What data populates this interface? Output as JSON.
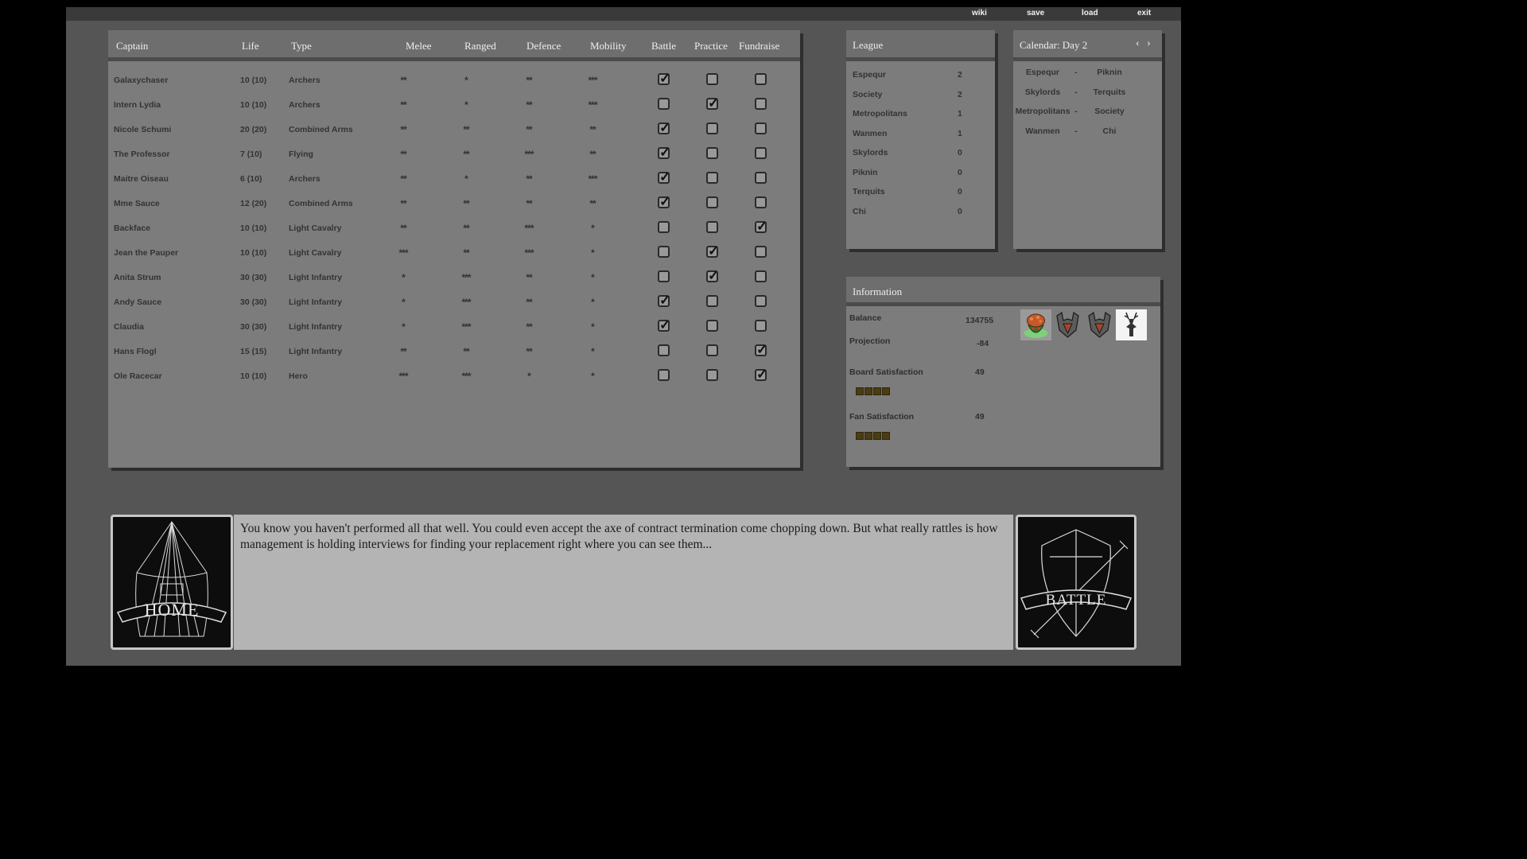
{
  "nav": {
    "wiki": "wiki",
    "save": "save",
    "load": "load",
    "exit": "exit"
  },
  "roster": {
    "headers": [
      "Captain",
      "Life",
      "Type",
      "Melee",
      "Ranged",
      "Defence",
      "Mobility",
      "Battle",
      "Practice",
      "Fundraise"
    ],
    "rows": [
      {
        "name": "Galaxychaser",
        "life": "10 (10)",
        "type": "Archers",
        "melee": "**",
        "ranged": "*",
        "defence": "**",
        "mobility": "***",
        "battle": true,
        "practice": false,
        "fundraise": false
      },
      {
        "name": "Intern Lydia",
        "life": "10 (10)",
        "type": "Archers",
        "melee": "**",
        "ranged": "*",
        "defence": "**",
        "mobility": "***",
        "battle": false,
        "practice": true,
        "fundraise": false
      },
      {
        "name": "Nicole Schumi",
        "life": "20 (20)",
        "type": "Combined Arms",
        "melee": "**",
        "ranged": "**",
        "defence": "**",
        "mobility": "**",
        "battle": true,
        "practice": false,
        "fundraise": false
      },
      {
        "name": "The Professor",
        "life": "7 (10)",
        "type": "Flying",
        "melee": "**",
        "ranged": "**",
        "defence": "***",
        "mobility": "**",
        "battle": true,
        "practice": false,
        "fundraise": false
      },
      {
        "name": "Maitre Oiseau",
        "life": "6 (10)",
        "type": "Archers",
        "melee": "**",
        "ranged": "*",
        "defence": "**",
        "mobility": "***",
        "battle": true,
        "practice": false,
        "fundraise": false
      },
      {
        "name": "Mme Sauce",
        "life": "12 (20)",
        "type": "Combined Arms",
        "melee": "**",
        "ranged": "**",
        "defence": "**",
        "mobility": "**",
        "battle": true,
        "practice": false,
        "fundraise": false
      },
      {
        "name": "Backface",
        "life": "10 (10)",
        "type": "Light Cavalry",
        "melee": "**",
        "ranged": "**",
        "defence": "***",
        "mobility": "*",
        "battle": false,
        "practice": false,
        "fundraise": true
      },
      {
        "name": "Jean the Pauper",
        "life": "10 (10)",
        "type": "Light Cavalry",
        "melee": "***",
        "ranged": "**",
        "defence": "***",
        "mobility": "*",
        "battle": false,
        "practice": true,
        "fundraise": false
      },
      {
        "name": "Anita Strum",
        "life": "30 (30)",
        "type": "Light Infantry",
        "melee": "*",
        "ranged": "***",
        "defence": "**",
        "mobility": "*",
        "battle": false,
        "practice": true,
        "fundraise": false
      },
      {
        "name": "Andy Sauce",
        "life": "30 (30)",
        "type": "Light Infantry",
        "melee": "*",
        "ranged": "***",
        "defence": "**",
        "mobility": "*",
        "battle": true,
        "practice": false,
        "fundraise": false
      },
      {
        "name": "Claudia",
        "life": "30 (30)",
        "type": "Light Infantry",
        "melee": "*",
        "ranged": "***",
        "defence": "**",
        "mobility": "*",
        "battle": true,
        "practice": false,
        "fundraise": false
      },
      {
        "name": "Hans Flogl",
        "life": "15 (15)",
        "type": "Light Infantry",
        "melee": "**",
        "ranged": "**",
        "defence": "**",
        "mobility": "*",
        "battle": false,
        "practice": false,
        "fundraise": true
      },
      {
        "name": "Ole Racecar",
        "life": "10 (10)",
        "type": "Hero",
        "melee": "***",
        "ranged": "***",
        "defence": "*",
        "mobility": "*",
        "battle": false,
        "practice": false,
        "fundraise": true
      }
    ]
  },
  "league": {
    "title": "League",
    "teams": [
      {
        "name": "Espequr",
        "points": "2"
      },
      {
        "name": "Society",
        "points": "2"
      },
      {
        "name": "Metropolitans",
        "points": "1"
      },
      {
        "name": "Wanmen",
        "points": "1"
      },
      {
        "name": "Skylords",
        "points": "0"
      },
      {
        "name": "Piknin",
        "points": "0"
      },
      {
        "name": "Terquits",
        "points": "0"
      },
      {
        "name": "Chi",
        "points": "0"
      }
    ]
  },
  "calendar": {
    "title": "Calendar: Day 2",
    "prev": "‹",
    "next": "›",
    "matches": [
      {
        "home": "Espequr",
        "sep": "-",
        "away": "Piknin"
      },
      {
        "home": "Skylords",
        "sep": "-",
        "away": "Terquits"
      },
      {
        "home": "Metropolitans",
        "sep": "-",
        "away": "Society"
      },
      {
        "home": "Wanmen",
        "sep": "-",
        "away": "Chi"
      }
    ]
  },
  "info": {
    "title": "Information",
    "balance_label": "Balance",
    "balance": "134755",
    "projection_label": "Projection",
    "projection": "-84",
    "board_label": "Board Satisfaction",
    "board": "49",
    "board_level": 4,
    "fan_label": "Fan Satisfaction",
    "fan": "49",
    "fan_level": 4,
    "badges": [
      "potion-icon",
      "helmet-icon",
      "helmet-icon",
      "deer-icon"
    ]
  },
  "home": {
    "label": "HOME",
    "icon": "tent-icon"
  },
  "battle": {
    "label": "BATTLE",
    "icon": "shield-sword-icon"
  },
  "story": "You know you haven't performed all that well. You could even accept the axe of contract termination come chopping down. But what really rattles is how management is holding interviews for finding your replacement right where you can see them...",
  "colors": {
    "background": "#555555",
    "panel": "#7c7c7c",
    "bar": "#4a3d10",
    "story_bg": "#b4b4b4"
  }
}
